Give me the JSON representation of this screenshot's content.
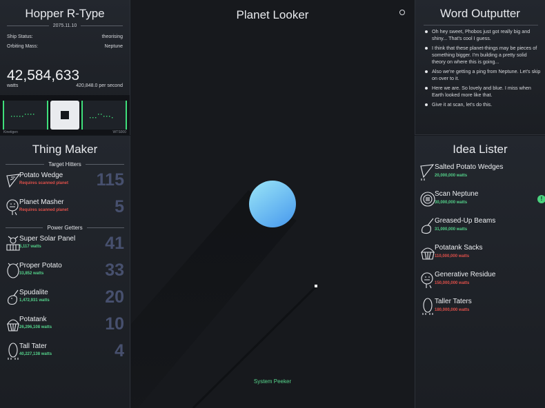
{
  "hopper": {
    "title": "Hopper R-Type",
    "date": "2075.11.10",
    "status_label": "Ship Status:",
    "status_value": "theorising",
    "mass_label": "Orbiting Mass:",
    "mass_value": "Neptune",
    "watts_total": "42,584,633",
    "watts_unit": "watts",
    "watts_rate": "420,848.0 per second",
    "left_screen_label": "Kinetigen",
    "right_screen_label": "WTS000"
  },
  "maker": {
    "title": "Thing Maker",
    "target_section": "Target Hitters",
    "power_section": "Power Getters",
    "targets": [
      {
        "name": "Potato Wedge",
        "sub": "Requires scanned planet",
        "count": "115",
        "icon": "wedge-icon"
      },
      {
        "name": "Planet Masher",
        "sub": "Requires scanned planet",
        "count": "5",
        "icon": "masher-icon"
      }
    ],
    "power": [
      {
        "name": "Super Solar Panel",
        "sub": "5,117 watts",
        "count": "41",
        "icon": "solar-panel-icon"
      },
      {
        "name": "Proper Potato",
        "sub": "33,852 watts",
        "count": "33",
        "icon": "potato-icon"
      },
      {
        "name": "Spudalite",
        "sub": "1,472,931 watts",
        "count": "20",
        "icon": "spudalite-icon"
      },
      {
        "name": "Potatank",
        "sub": "26,296,108 watts",
        "count": "10",
        "icon": "potatank-icon"
      },
      {
        "name": "Tall Tater",
        "sub": "40,227,138 watts",
        "count": "4",
        "icon": "tall-tater-icon"
      }
    ]
  },
  "looker": {
    "title": "Planet Looker",
    "peeker_label": "System Peeker",
    "planet_color": "#6fc4f0"
  },
  "words": {
    "title": "Word Outputter",
    "messages": [
      "Oh hey sweet, Phobos just got really big and shiny... That's cool I guess.",
      "I think that these planet-things may be pieces of something bigger. I'm building a pretty solid theory on where this is going...",
      "Also we're getting a ping from Neptune. Let's skip on over to it.",
      "Here we are. So lovely and blue. I miss when Earth looked more like that.",
      "Give it at scan, let's do this."
    ]
  },
  "ideas": {
    "title": "Idea Lister",
    "items": [
      {
        "name": "Salted Potato Wedges",
        "sub": "20,000,000 watts",
        "affordable": true,
        "icon": "salted-wedge-icon"
      },
      {
        "name": "Scan Neptune",
        "sub": "30,000,000 watts",
        "affordable": true,
        "icon": "scan-icon"
      },
      {
        "name": "Greased-Up Beams",
        "sub": "31,000,000 watts",
        "affordable": true,
        "icon": "beams-icon"
      },
      {
        "name": "Potatank Sacks",
        "sub": "110,000,000 watts",
        "affordable": false,
        "icon": "potatank-sacks-icon"
      },
      {
        "name": "Generative Residue",
        "sub": "150,000,000 watts",
        "affordable": false,
        "icon": "residue-icon"
      },
      {
        "name": "Taller Taters",
        "sub": "180,000,000 watts",
        "affordable": false,
        "icon": "taller-taters-icon"
      }
    ],
    "side_tab": "!"
  }
}
